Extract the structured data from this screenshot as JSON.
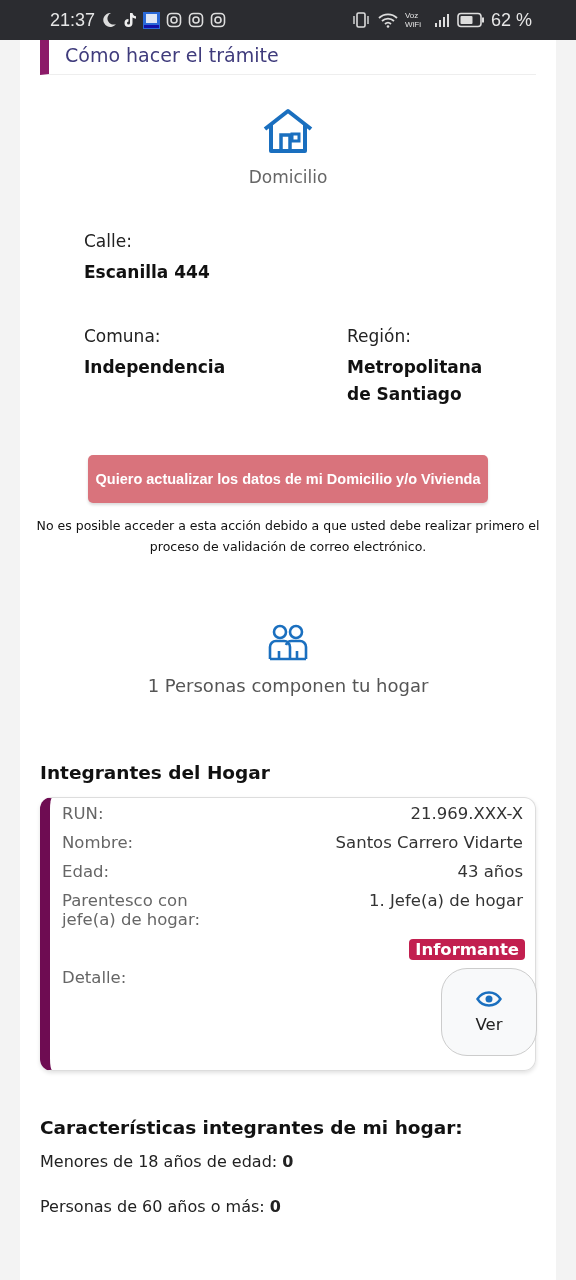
{
  "status_bar": {
    "time": "21:37",
    "wifi_label": "Voz WiFi",
    "battery": "62 %"
  },
  "section": {
    "title": "Cómo hacer el trámite"
  },
  "domicilio": {
    "title": "Domicilio",
    "fields": [
      {
        "label": "Calle:",
        "value": "Escanilla 444"
      },
      {
        "label": "Comuna:",
        "value": "Independencia"
      },
      {
        "label": "Región:",
        "value": "Metropolitana de Santiago"
      }
    ],
    "update_button": {
      "label": "Quiero actualizar los datos de mi Domicilio y/o Vivienda",
      "disabled": true
    },
    "notice": "No es posible acceder a esta acción debido a que usted debe realizar primero el proceso de validación de correo electrónico."
  },
  "hogar": {
    "summary": "1 Personas componen tu hogar"
  },
  "integrantes": {
    "title": "Integrantes del Hogar",
    "members": [
      {
        "fields": [
          {
            "label": "RUN:",
            "value": "21.969.XXX-X"
          },
          {
            "label": "Nombre:",
            "value": "Santos Carrero Vidarte"
          },
          {
            "label": "Edad:",
            "value": "43  años"
          },
          {
            "label": "Parentesco con jefe(a) de hogar:",
            "value": "1. Jefe(a) de hogar"
          }
        ],
        "badge": "Informante",
        "detail_label": "Detalle:",
        "detail_button": "Ver"
      }
    ]
  },
  "caracteristicas": {
    "title": "Características integrantes de mi hogar:",
    "items": [
      "Menores de 18 años de edad: **0**",
      "Personas de 60 años o más: **0**"
    ]
  }
}
